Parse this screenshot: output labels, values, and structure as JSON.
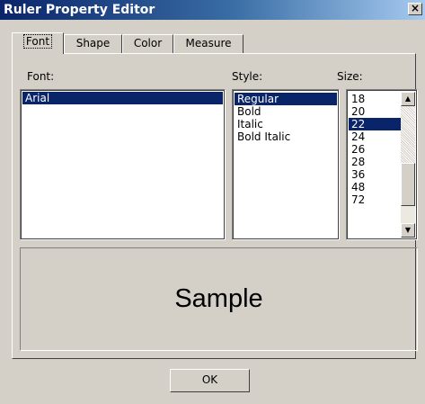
{
  "window": {
    "title": "Ruler Property Editor",
    "close_label": "×"
  },
  "tabs": [
    {
      "label": "Font",
      "active": true
    },
    {
      "label": "Shape",
      "active": false
    },
    {
      "label": "Color",
      "active": false
    },
    {
      "label": "Measure",
      "active": false
    }
  ],
  "font_tab": {
    "font_label": "Font:",
    "style_label": "Style:",
    "size_label": "Size:",
    "fonts": [
      "Arial"
    ],
    "selected_font": "Arial",
    "styles": [
      "Regular",
      "Bold",
      "Italic",
      "Bold Italic"
    ],
    "selected_style": "Regular",
    "sizes": [
      "18",
      "20",
      "22",
      "24",
      "26",
      "28",
      "36",
      "48",
      "72"
    ],
    "selected_size": "22",
    "sample_text": "Sample"
  },
  "buttons": {
    "ok_label": "OK"
  },
  "colors": {
    "selection": "#0a246a",
    "face": "#d4d0c8"
  }
}
